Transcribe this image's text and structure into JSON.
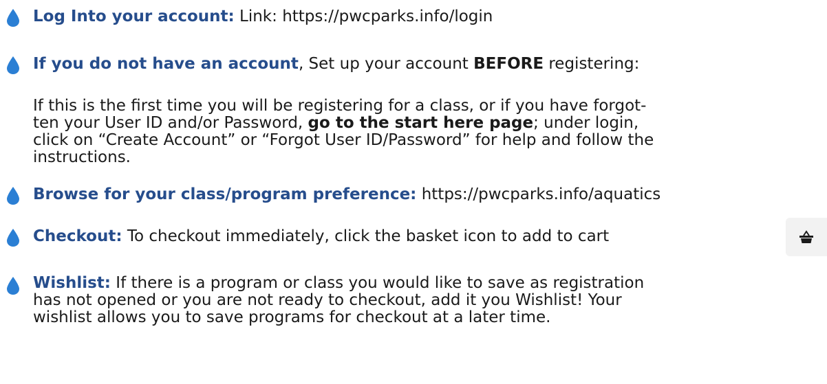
{
  "colors": {
    "accent": "#264d8c",
    "bullet": "#2b7fd4",
    "text": "#1a1a1a"
  },
  "icons": {
    "bullet": "water-drop-icon",
    "basket": "shopping-basket-icon"
  },
  "steps": [
    {
      "heading": "Log Into your account:",
      "text": " Link: https://pwcparks.info/login"
    },
    {
      "heading": "If you do not have an account",
      "text_a": ", Set up your account ",
      "strong": "BEFORE",
      "text_b": " registering:",
      "paragraph": {
        "l1": "If this is the first time you will be registering for a class, or if you have forgot-",
        "l2a": "ten your User ID and/or Password, ",
        "l2_strong": "go to the start here page",
        "l2b": "; under login,",
        "l3": "click on “Create Account” or “Forgot User ID/Password” for help and follow the",
        "l4": "instructions."
      }
    },
    {
      "heading": "Browse for your class/program preference:",
      "text": " https://pwcparks.info/aquatics"
    },
    {
      "heading": "Checkout:",
      "text": " To checkout immediately, click the basket icon to add to cart"
    },
    {
      "heading": "Wishlist:",
      "l1": " If there is a program or class you would like to save as registration",
      "l2": "has not opened or you are not ready to checkout, add it you Wishlist! Your",
      "l3": "wishlist allows you to save programs for checkout at a later time."
    }
  ]
}
